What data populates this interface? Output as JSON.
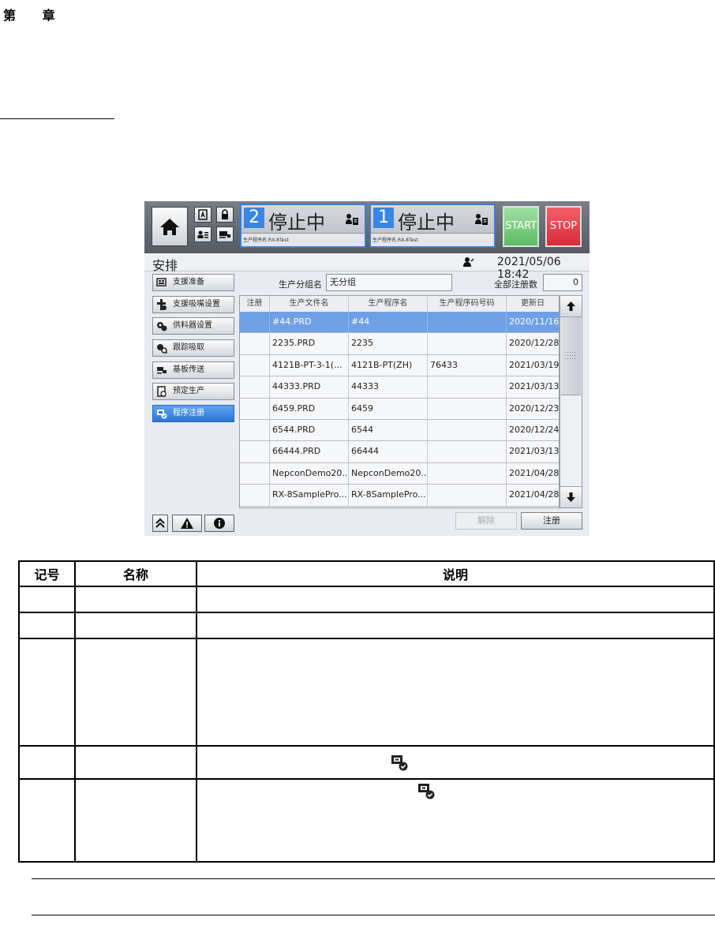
{
  "chapter": {
    "label": "第 章"
  },
  "ui": {
    "lanes": [
      {
        "number": "2",
        "status": "停止中",
        "program": "生产程序名:RX-8Test"
      },
      {
        "number": "1",
        "status": "停止中",
        "program": "生产程序名:RX-8Test"
      }
    ],
    "start_label": "START",
    "stop_label": "STOP",
    "screen_title": "安排",
    "datetime": "2021/05/06 18:42",
    "sidebar": [
      {
        "label": "支援准备",
        "icon": "support-prep-icon"
      },
      {
        "label": "支援吸嘴设置",
        "icon": "nozzle-setup-icon"
      },
      {
        "label": "供料器设置",
        "icon": "feeder-setup-icon"
      },
      {
        "label": "跟踪吸取",
        "icon": "pickup-tracking-icon"
      },
      {
        "label": "基板传送",
        "icon": "board-transfer-icon"
      },
      {
        "label": "预定生产",
        "icon": "scheduled-production-icon"
      },
      {
        "label": "程序注册",
        "icon": "program-register-icon",
        "active": true
      }
    ],
    "group_label": "生产分组名",
    "group_value": "无分组",
    "count_label": "全部注册数",
    "count_value": "0",
    "table": {
      "headers": [
        "注册",
        "生产文件名",
        "生产程序名",
        "生产程序码号码",
        "更新日"
      ],
      "rows": [
        {
          "reg": "",
          "file": "#44.PRD",
          "prog": "#44",
          "code": "",
          "date": "2020/11/16",
          "selected": true
        },
        {
          "reg": "",
          "file": "2235.PRD",
          "prog": "2235",
          "code": "",
          "date": "2020/12/28"
        },
        {
          "reg": "",
          "file": "4121B-PT-3-1(...",
          "prog": "4121B-PT(ZH)",
          "code": "76433",
          "date": "2021/03/19"
        },
        {
          "reg": "",
          "file": "44333.PRD",
          "prog": "44333",
          "code": "",
          "date": "2021/03/13"
        },
        {
          "reg": "",
          "file": "6459.PRD",
          "prog": "6459",
          "code": "",
          "date": "2020/12/23"
        },
        {
          "reg": "",
          "file": "6544.PRD",
          "prog": "6544",
          "code": "",
          "date": "2020/12/24"
        },
        {
          "reg": "",
          "file": "66444.PRD",
          "prog": "66444",
          "code": "",
          "date": "2021/03/13"
        },
        {
          "reg": "",
          "file": "NepconDemo20...",
          "prog": "NepconDemo20...",
          "code": "",
          "date": "2021/04/28"
        },
        {
          "reg": "",
          "file": "RX-8SamplePro...",
          "prog": "RX-8SamplePro...",
          "code": "",
          "date": "2021/04/28"
        }
      ]
    },
    "cancel_label": "解除",
    "register_label": "注册"
  },
  "doc_table": {
    "headers": [
      "记号",
      "名称",
      "说明"
    ]
  }
}
